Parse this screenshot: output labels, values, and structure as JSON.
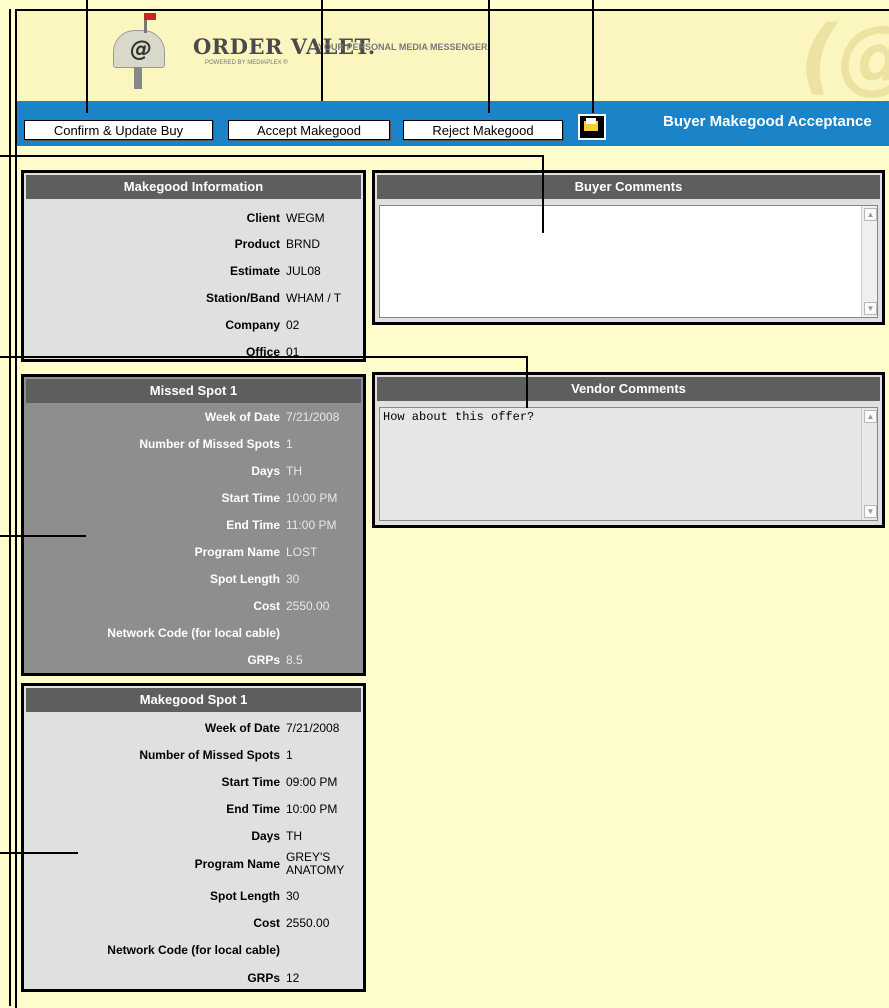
{
  "header": {
    "logo_title": "ORDER VALET.",
    "logo_tagline": "YOUR PERSONAL MEDIA MESSENGER",
    "logo_sub": "POWERED BY MEDIAPLEX ®",
    "logo_at": "@",
    "big_at": "(@"
  },
  "toolbar": {
    "confirm_label": "Confirm & Update Buy",
    "accept_label": "Accept Makegood",
    "reject_label": "Reject Makegood",
    "print_icon": "print-icon",
    "page_title": "Buyer Makegood Acceptance",
    "bar_color": "#1b83c8"
  },
  "makegood_info": {
    "title": "Makegood Information",
    "rows": [
      {
        "label": "Client",
        "value": "WEGM"
      },
      {
        "label": "Product",
        "value": "BRND"
      },
      {
        "label": "Estimate",
        "value": "JUL08"
      },
      {
        "label": "Station/Band",
        "value": "WHAM / T"
      },
      {
        "label": "Company",
        "value": "02"
      },
      {
        "label": "Office",
        "value": "01"
      }
    ]
  },
  "missed_spot": {
    "title": "Missed Spot 1",
    "rows": [
      {
        "label": "Week of Date",
        "value": "7/21/2008"
      },
      {
        "label": "Number of Missed Spots",
        "value": "1"
      },
      {
        "label": "Days",
        "value": "TH"
      },
      {
        "label": "Start Time",
        "value": "10:00 PM"
      },
      {
        "label": "End Time",
        "value": "11:00 PM"
      },
      {
        "label": "Program Name",
        "value": "LOST"
      },
      {
        "label": "Spot Length",
        "value": "30"
      },
      {
        "label": "Cost",
        "value": "2550.00"
      },
      {
        "label": "Network Code (for local cable)",
        "value": ""
      },
      {
        "label": "GRPs",
        "value": "8.5"
      }
    ]
  },
  "makegood_spot": {
    "title": "Makegood Spot 1",
    "rows": [
      {
        "label": "Week of Date",
        "value": "7/21/2008"
      },
      {
        "label": "Number of Missed Spots",
        "value": "1"
      },
      {
        "label": "Start Time",
        "value": "09:00 PM"
      },
      {
        "label": "End Time",
        "value": "10:00 PM"
      },
      {
        "label": "Days",
        "value": "TH"
      },
      {
        "label": "Program Name",
        "value": "GREY'S ANATOMY"
      },
      {
        "label": "Spot Length",
        "value": "30"
      },
      {
        "label": "Cost",
        "value": "2550.00"
      },
      {
        "label": "Network Code (for local cable)",
        "value": ""
      },
      {
        "label": "GRPs",
        "value": "12"
      }
    ]
  },
  "buyer_comments": {
    "title": "Buyer Comments",
    "value": ""
  },
  "vendor_comments": {
    "title": "Vendor Comments",
    "value": "How about this offer?"
  }
}
